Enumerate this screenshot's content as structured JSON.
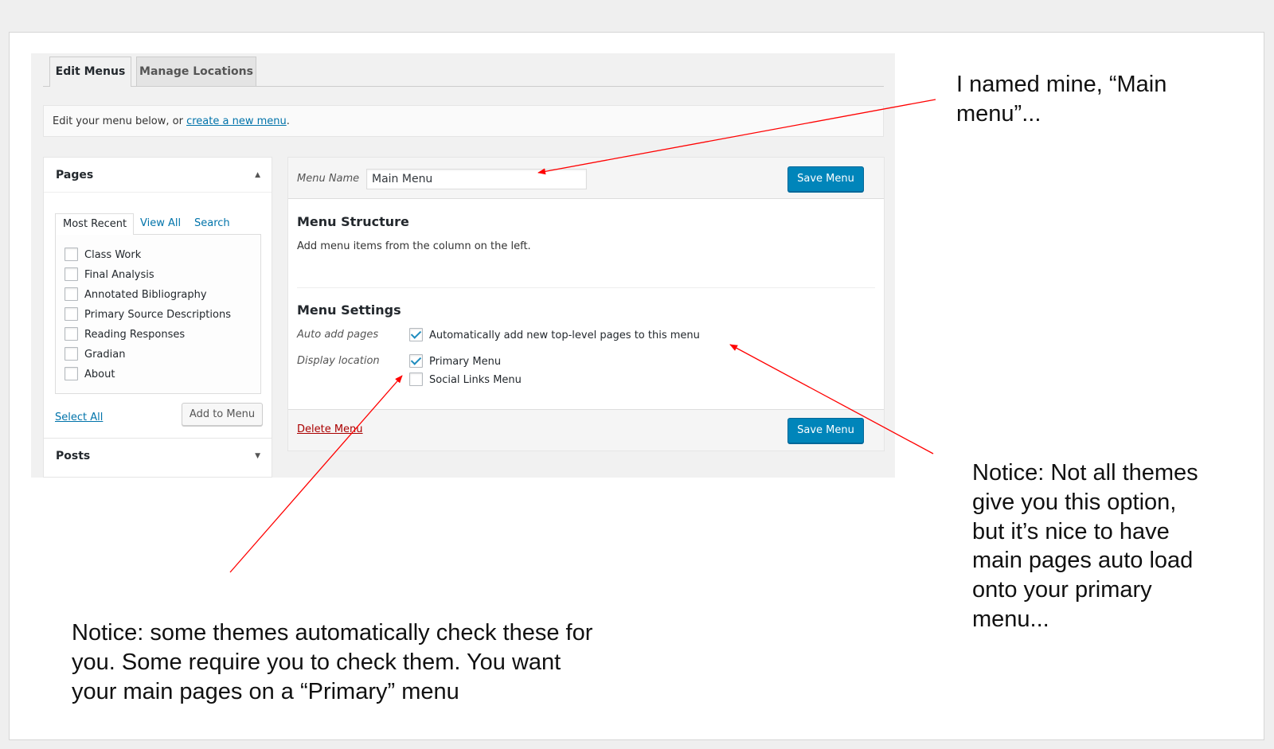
{
  "tabs": {
    "edit_menus": "Edit Menus",
    "manage_locations": "Manage Locations"
  },
  "info": {
    "prefix": "Edit your menu below, or ",
    "link": "create a new menu",
    "suffix": "."
  },
  "pages_panel": {
    "title": "Pages",
    "subtabs": [
      "Most Recent",
      "View All",
      "Search"
    ],
    "items": [
      "Class Work",
      "Final Analysis",
      "Annotated Bibliography",
      "Primary Source Descriptions",
      "Reading Responses",
      "Gradian",
      "About"
    ],
    "select_all": "Select All",
    "add_to_menu": "Add to Menu"
  },
  "posts_panel": {
    "title": "Posts"
  },
  "menu_editor": {
    "name_label": "Menu Name",
    "name_value": "Main Menu",
    "save_label": "Save Menu",
    "structure_title": "Menu Structure",
    "structure_hint": "Add menu items from the column on the left.",
    "settings_title": "Menu Settings",
    "auto_add_label": "Auto add pages",
    "auto_add_option": "Automatically add new top-level pages to this menu",
    "auto_add_checked": true,
    "display_location_label": "Display location",
    "locations": [
      {
        "label": "Primary Menu",
        "checked": true
      },
      {
        "label": "Social Links Menu",
        "checked": false
      }
    ],
    "delete_label": "Delete Menu"
  },
  "annotations": {
    "note_top": [
      "I named mine, “Main",
      "menu”..."
    ],
    "note_right": [
      "Notice: Not all themes",
      "give you this option,",
      "but it’s nice to have",
      "main pages auto load",
      "onto your primary",
      "menu..."
    ],
    "note_bottom": [
      "Notice: some themes automatically check these for",
      "you. Some require you to check them. You want",
      "your main pages on a “Primary” menu"
    ]
  },
  "colors": {
    "primary_button": "#0085ba",
    "link": "#0073aa",
    "delete": "#aa0000",
    "arrow": "#ff0000"
  }
}
